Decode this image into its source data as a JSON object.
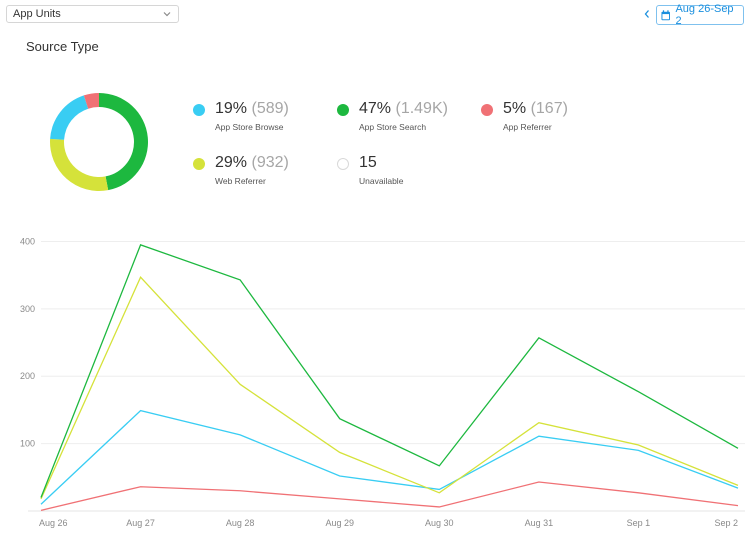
{
  "header": {
    "metric_select": {
      "value": "App Units"
    },
    "date_range": "Aug 26-Sep 2"
  },
  "section_title": "Source Type",
  "colors": {
    "browse": "#39cdf3",
    "search": "#1db83f",
    "referrer": "#f07175",
    "web": "#d5e23a",
    "unavailable": "#d9d9d9"
  },
  "legend": [
    {
      "key": "browse",
      "percent": "19%",
      "count": "(589)",
      "name": "App Store Browse",
      "color": "#39cdf3"
    },
    {
      "key": "search",
      "percent": "47%",
      "count": "(1.49K)",
      "name": "App Store Search",
      "color": "#1db83f"
    },
    {
      "key": "referrer",
      "percent": "5%",
      "count": "(167)",
      "name": "App Referrer",
      "color": "#f07175"
    },
    {
      "key": "web",
      "percent": "29%",
      "count": "(932)",
      "name": "Web Referrer",
      "color": "#d5e23a"
    },
    {
      "key": "unavailable",
      "percent": "15",
      "count": "",
      "name": "Unavailable",
      "color": "#d9d9d9"
    }
  ],
  "donut": {
    "slices": [
      {
        "name": "App Store Search",
        "value": 47,
        "color": "#1db83f"
      },
      {
        "name": "Web Referrer",
        "value": 29,
        "color": "#d5e23a"
      },
      {
        "name": "App Store Browse",
        "value": 19,
        "color": "#39cdf3"
      },
      {
        "name": "App Referrer",
        "value": 5,
        "color": "#f07175"
      }
    ]
  },
  "chart_data": {
    "type": "line",
    "x": [
      "Aug 26",
      "Aug 27",
      "Aug 28",
      "Aug 29",
      "Aug 30",
      "Aug 31",
      "Sep 1",
      "Sep 2"
    ],
    "y_ticks": [
      100,
      200,
      300,
      400
    ],
    "ylim": [
      0,
      420
    ],
    "grid": true,
    "series": [
      {
        "name": "App Store Search",
        "color": "#1db83f",
        "values": [
          20,
          395,
          343,
          137,
          67,
          257,
          177,
          93
        ]
      },
      {
        "name": "Web Referrer",
        "color": "#d5e23a",
        "values": [
          18,
          347,
          188,
          87,
          27,
          131,
          98,
          38
        ]
      },
      {
        "name": "App Store Browse",
        "color": "#39cdf3",
        "values": [
          10,
          149,
          113,
          52,
          32,
          111,
          90,
          34
        ]
      },
      {
        "name": "App Referrer",
        "color": "#f07175",
        "values": [
          1,
          36,
          30,
          18,
          6,
          43,
          27,
          8
        ]
      }
    ]
  }
}
